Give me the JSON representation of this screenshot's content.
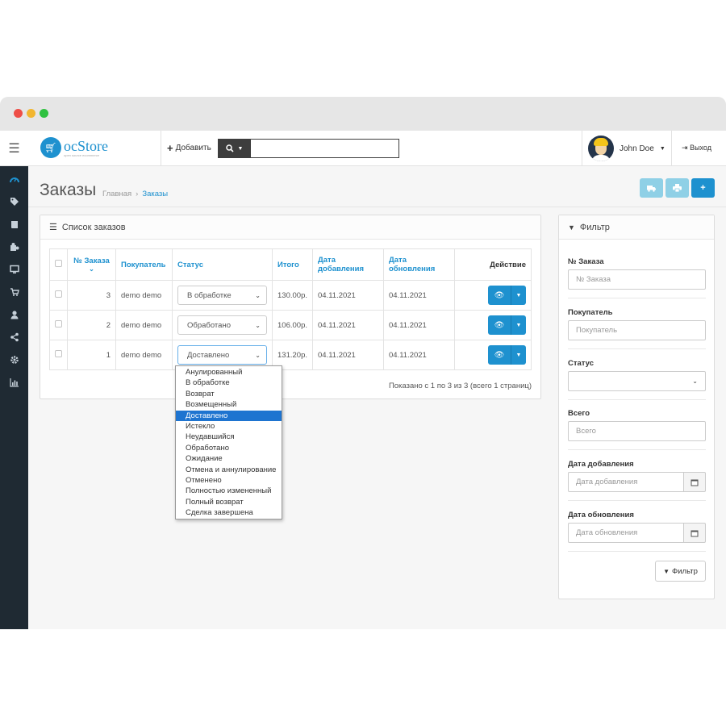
{
  "header": {
    "logo_name": "ocStore",
    "logo_tagline": "open source ecommerce",
    "add_label": "Добавить",
    "search_placeholder": "",
    "user_name": "John Doe",
    "logout_label": "Выход"
  },
  "sidebar": {
    "icons": [
      "dashboard-icon",
      "tag-icon",
      "book-icon",
      "puzzle-icon",
      "monitor-icon",
      "cart-icon",
      "user-icon",
      "share-icon",
      "gear-icon",
      "bar-chart-icon"
    ]
  },
  "page": {
    "title": "Заказы",
    "breadcrumb_home": "Главная",
    "breadcrumb_sep": "›",
    "breadcrumb_current": "Заказы"
  },
  "orders": {
    "panel_title": "Список заказов",
    "columns": {
      "order_no": "№ Заказа",
      "customer": "Покупатель",
      "status": "Статус",
      "total": "Итого",
      "date_added_1": "Дата",
      "date_added_2": "добавления",
      "date_modified_1": "Дата",
      "date_modified_2": "обновления",
      "action": "Действие"
    },
    "rows": [
      {
        "order_no": "3",
        "customer": "demo demo",
        "status": "В обработке",
        "total": "130.00р.",
        "date_added": "04.11.2021",
        "date_modified": "04.11.2021"
      },
      {
        "order_no": "2",
        "customer": "demo demo",
        "status": "Обработано",
        "total": "106.00р.",
        "date_added": "04.11.2021",
        "date_modified": "04.11.2021"
      },
      {
        "order_no": "1",
        "customer": "demo demo",
        "status": "Доставлено",
        "total": "131.20р.",
        "date_added": "04.11.2021",
        "date_modified": "04.11.2021"
      }
    ],
    "pagination_text": "Показано с 1 по 3 из 3 (всего 1 страниц)"
  },
  "status_dropdown": {
    "options": [
      "Анулированный",
      "В обработке",
      "Возврат",
      "Возмещенный",
      "Доставлено",
      "Истекло",
      "Неудавшийся",
      "Обработано",
      "Ожидание",
      "Отмена и аннулирование",
      "Отменено",
      "Полностью измененный",
      "Полный возврат",
      "Сделка завершена"
    ],
    "selected_index": 4
  },
  "filter": {
    "panel_title": "Фильтр",
    "order_id_label": "№ Заказа",
    "order_id_placeholder": "№ Заказа",
    "customer_label": "Покупатель",
    "customer_placeholder": "Покупатель",
    "status_label": "Статус",
    "status_value": "",
    "total_label": "Всего",
    "total_placeholder": "Всего",
    "date_added_label": "Дата добавления",
    "date_added_placeholder": "Дата добавления",
    "date_modified_label": "Дата обновления",
    "date_modified_placeholder": "Дата обновления",
    "button_label": "Фильтр"
  },
  "colors": {
    "accent": "#1e91cf",
    "sidebar_bg": "#1f2a33",
    "selected_option": "#1e74d0"
  }
}
